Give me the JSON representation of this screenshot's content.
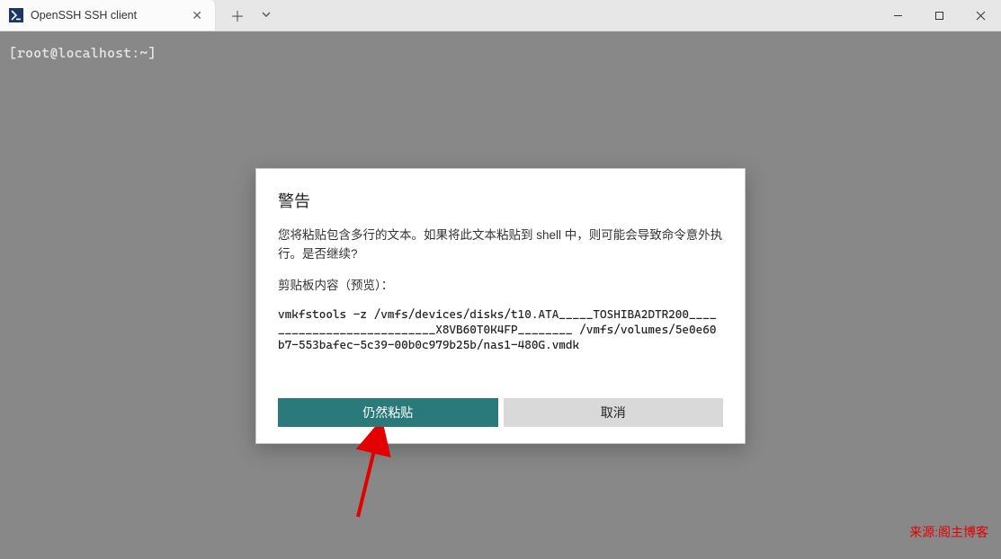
{
  "tab": {
    "title": "OpenSSH SSH client",
    "icon_label": ">_"
  },
  "terminal": {
    "prompt": "[root@localhost:~]"
  },
  "dialog": {
    "title": "警告",
    "warning_text": "您将粘贴包含多行的文本。如果将此文本粘贴到 shell 中，则可能会导致命令意外执行。是否继续?",
    "clipboard_label": "剪贴板内容（预览）：",
    "clipboard_preview": "vmkfstools -z /vmfs/devices/disks/t10.ATA_____TOSHIBA2DTR200___________________________X8VB60T0K4FP________ /vmfs/volumes/5e0e60b7-553bafec-5c39-00b0c979b25b/nas1-480G.vmdk",
    "paste_button": "仍然粘贴",
    "cancel_button": "取消"
  },
  "watermark": "来源:阁主博客"
}
